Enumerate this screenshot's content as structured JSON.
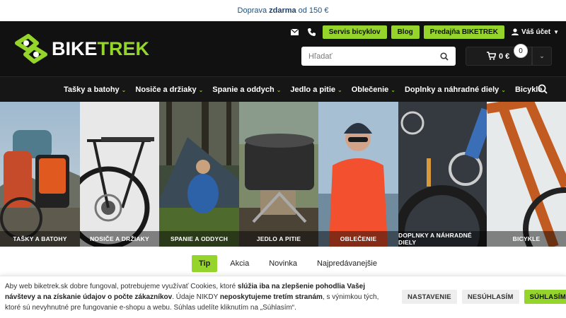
{
  "topbar": {
    "prefix": "Doprava",
    "highlight": "zdarma",
    "suffix": "od 150 €"
  },
  "header": {
    "logo": {
      "part1": "BIKE",
      "part2": "TREK"
    },
    "icons": [
      "mail-icon",
      "phone-icon",
      "user-icon",
      "search-icon",
      "cart-icon"
    ],
    "links": [
      "Servis bicyklov",
      "Blog",
      "Predajňa BIKETREK"
    ],
    "account_label": "Váš účet",
    "search_placeholder": "Hľadať",
    "cart_amount": "0 €",
    "cart_count": "0"
  },
  "nav": {
    "items": [
      {
        "label": "Tašky a batohy",
        "has_dropdown": true
      },
      {
        "label": "Nosiče a držiaky",
        "has_dropdown": true
      },
      {
        "label": "Spanie a oddych",
        "has_dropdown": true
      },
      {
        "label": "Jedlo a pitie",
        "has_dropdown": true
      },
      {
        "label": "Oblečenie",
        "has_dropdown": true
      },
      {
        "label": "Doplnky a náhradné diely",
        "has_dropdown": true
      },
      {
        "label": "Bicykle",
        "has_dropdown": false
      }
    ]
  },
  "tiles": [
    {
      "label": "Tašky a batohy"
    },
    {
      "label": "Nosiče a držiaky"
    },
    {
      "label": "Spanie a oddych"
    },
    {
      "label": "Jedlo a pitie"
    },
    {
      "label": "Oblečenie"
    },
    {
      "label": "Doplnky a náhradné diely"
    },
    {
      "label": "Bicykle"
    }
  ],
  "tabs": [
    {
      "label": "Tip",
      "active": true
    },
    {
      "label": "Akcia",
      "active": false
    },
    {
      "label": "Novinka",
      "active": false
    },
    {
      "label": "Najpredávanejšie",
      "active": false
    }
  ],
  "cookie": {
    "t1": "Aby web biketrek.sk dobre fungoval, potrebujeme využívať Cookies, ktoré ",
    "b1": "slúžia iba na zlepšenie pohodlia Vašej návštevy a na získanie údajov o počte zákazníkov",
    "t2": ". Údaje NIKDY ",
    "b2": "neposkytujeme tretím stranám",
    "t3": ", s výnimkou tých, ktoré sú nevyhnutné pre fungovanie e-shopu a webu. Súhlas udelíte kliknutím na „Súhlasím“.",
    "buttons": {
      "settings": "NASTAVENIE",
      "decline": "NESÚHLASÍM",
      "accept": "SÚHLASÍM"
    }
  },
  "colors": {
    "accent": "#95d52b",
    "header_bg": "#111111",
    "nav_bg": "#161616"
  }
}
